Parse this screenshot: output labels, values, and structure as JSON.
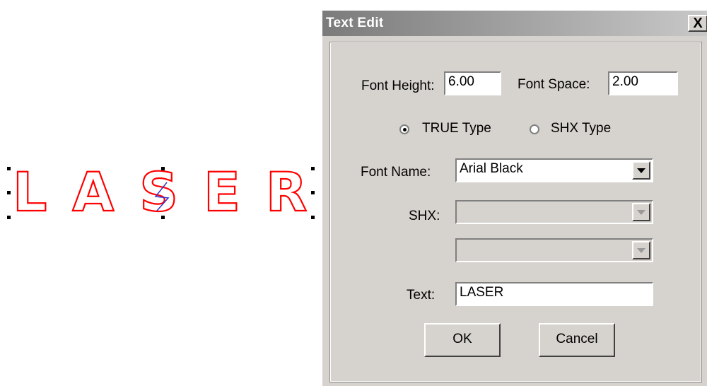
{
  "canvas": {
    "text": "LASER",
    "outline_color": "#ff0000"
  },
  "dialog": {
    "title": "Text Edit",
    "close_label": "X",
    "font_height_label": "Font Height:",
    "font_height_value": "6.00",
    "font_space_label": "Font Space:",
    "font_space_value": "2.00",
    "radio_true_label": "TRUE Type",
    "radio_shx_label": "SHX Type",
    "selected_type": "TRUE Type",
    "font_name_label": "Font Name:",
    "font_name_value": "Arial Black",
    "shx_label": "SHX:",
    "shx_value": "",
    "shx_big_value": "",
    "text_label": "Text:",
    "text_value": "LASER",
    "ok_label": "OK",
    "cancel_label": "Cancel"
  }
}
